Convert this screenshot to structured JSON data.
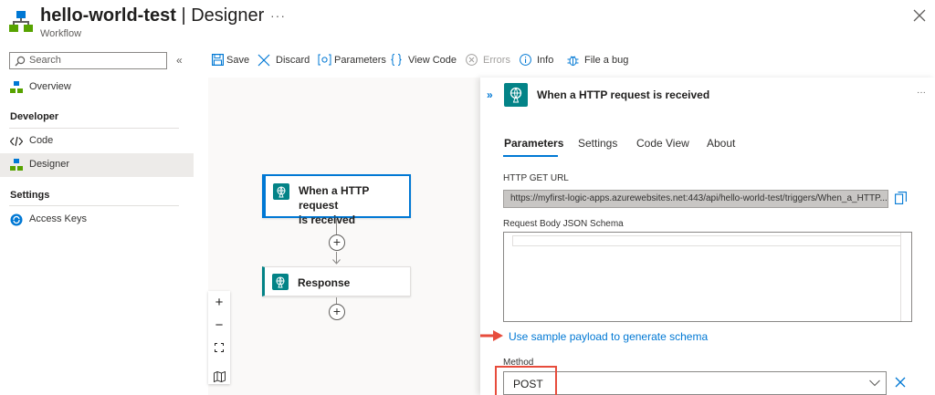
{
  "header": {
    "title": "hello-world-test",
    "title_suffix": "| Designer",
    "subtitle": "Workflow",
    "more": "···"
  },
  "sidebar": {
    "search_placeholder": "Search",
    "collapse": "«",
    "overview": "Overview",
    "developer_heading": "Developer",
    "code": "Code",
    "designer": "Designer",
    "settings_heading": "Settings",
    "access_keys": "Access Keys"
  },
  "toolbar": {
    "save": "Save",
    "discard": "Discard",
    "parameters": "Parameters",
    "view_code": "View Code",
    "errors": "Errors",
    "info": "Info",
    "file_bug": "File a bug"
  },
  "canvas": {
    "trigger_label_line1": "When a HTTP request",
    "trigger_label_line2": "is received",
    "action_label": "Response",
    "zoom_in": "+",
    "zoom_out": "−"
  },
  "panel": {
    "expand": "»",
    "title": "When a HTTP request is received",
    "more": "···",
    "tabs": [
      "Parameters",
      "Settings",
      "Code View",
      "About"
    ],
    "http_get_url_label": "HTTP GET URL",
    "http_get_url": "https://myfirst-logic-apps.azurewebsites.net:443/api/hello-world-test/triggers/When_a_HTTP...",
    "schema_label": "Request Body JSON Schema",
    "sample_link": "Use sample payload to generate schema",
    "method_label": "Method",
    "method_value": "POST"
  },
  "colors": {
    "accent": "#0078d4",
    "connector_teal": "#038387",
    "highlight_red": "#e74c3c"
  }
}
